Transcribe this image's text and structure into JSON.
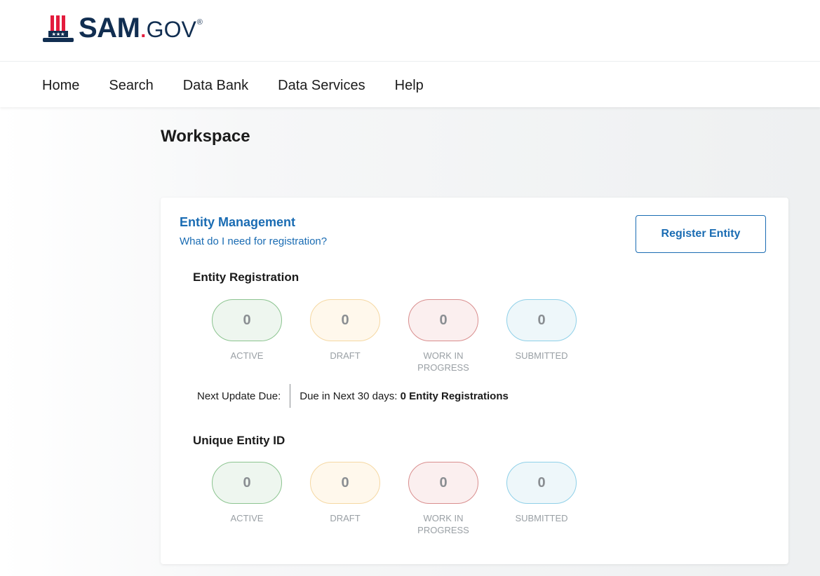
{
  "brand": {
    "name": "SAM",
    "dot": ".",
    "suffix": "GOV",
    "registered": "®",
    "colors": {
      "navy": "#112e51",
      "red": "#e31c3d",
      "link": "#1a6cb3"
    }
  },
  "nav": {
    "items": [
      {
        "label": "Home"
      },
      {
        "label": "Search"
      },
      {
        "label": "Data Bank"
      },
      {
        "label": "Data Services"
      },
      {
        "label": "Help"
      }
    ]
  },
  "page": {
    "title": "Workspace"
  },
  "entity_management": {
    "title": "Entity Management",
    "help_link": "What do I need for registration?",
    "register_button": "Register Entity",
    "registration": {
      "title": "Entity Registration",
      "stats": [
        {
          "value": "0",
          "label": "ACTIVE"
        },
        {
          "value": "0",
          "label": "DRAFT"
        },
        {
          "value": "0",
          "label": "WORK IN PROGRESS"
        },
        {
          "value": "0",
          "label": "SUBMITTED"
        }
      ],
      "next_update_label": "Next Update Due:",
      "due_prefix": "Due in Next 30 days: ",
      "due_value": "0 Entity Registrations"
    },
    "unique_id": {
      "title": "Unique Entity ID",
      "stats": [
        {
          "value": "0",
          "label": "ACTIVE"
        },
        {
          "value": "0",
          "label": "DRAFT"
        },
        {
          "value": "0",
          "label": "WORK IN PROGRESS"
        },
        {
          "value": "0",
          "label": "SUBMITTED"
        }
      ]
    }
  }
}
